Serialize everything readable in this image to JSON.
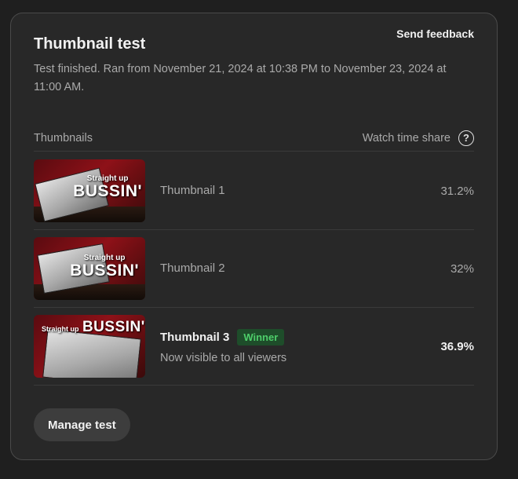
{
  "card": {
    "title": "Thumbnail test",
    "feedback_label": "Send feedback",
    "description": "Test finished. Ran from November 21, 2024 at 10:38 PM to November 23, 2024 at 11:00 AM."
  },
  "table": {
    "col_thumbnails": "Thumbnails",
    "col_share": "Watch time share",
    "help_icon": "?",
    "rows": [
      {
        "name": "Thumbnail 1",
        "share": "31.2%",
        "thumb_text_small": "Straight up",
        "thumb_text_big": "BUSSIN'"
      },
      {
        "name": "Thumbnail 2",
        "share": "32%",
        "thumb_text_small": "Straight up",
        "thumb_text_big": "BUSSIN'"
      },
      {
        "name": "Thumbnail 3",
        "share": "36.9%",
        "badge": "Winner",
        "subtitle": "Now visible to all viewers",
        "thumb_text_small": "Straight up",
        "thumb_text_big": "BUSSIN'"
      }
    ]
  },
  "actions": {
    "manage_label": "Manage test"
  },
  "colors": {
    "background": "#1f1f1f",
    "card": "#282828",
    "winner_badge_bg": "#1e4d2a",
    "winner_badge_text": "#4ece6a",
    "thumbnail_red": "#8e1118"
  }
}
